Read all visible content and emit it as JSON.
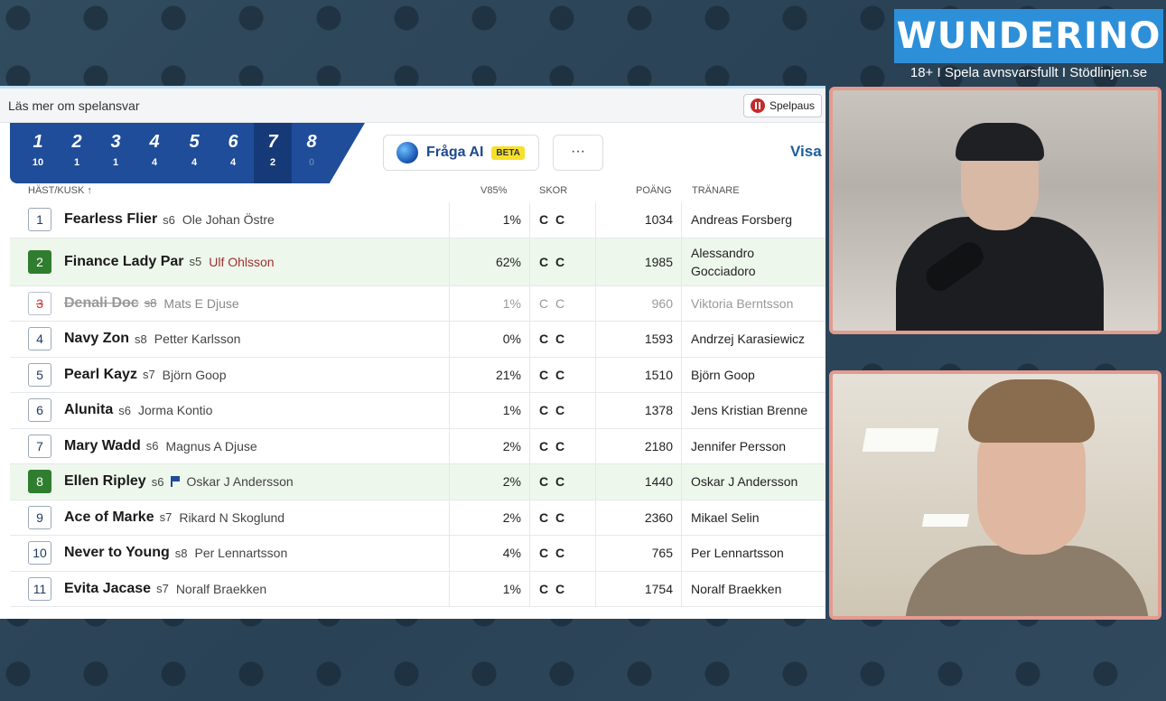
{
  "brand": {
    "logo": "WUNDERINO",
    "tagline": "18+ I Spela avnsvarsfullt I Stödlinjen.se"
  },
  "topbar": {
    "link": "Läs mer om spelansvar",
    "spelpaus": "Spelpaus"
  },
  "race_tabs": [
    {
      "num": "1",
      "count": "10"
    },
    {
      "num": "2",
      "count": "1"
    },
    {
      "num": "3",
      "count": "1"
    },
    {
      "num": "4",
      "count": "4"
    },
    {
      "num": "5",
      "count": "4"
    },
    {
      "num": "6",
      "count": "4"
    },
    {
      "num": "7",
      "count": "2",
      "active": true
    },
    {
      "num": "8",
      "count": "0"
    }
  ],
  "toolbar": {
    "ai_label": "Fråga AI",
    "beta": "BETA",
    "more": "···",
    "visa": "Visa"
  },
  "columns": {
    "horse": "HÄST/KUSK ↑",
    "v85": "V85%",
    "skor": "SKOR",
    "poang": "POÄNG",
    "tranare": "TRÄNARE"
  },
  "rows": [
    {
      "n": "1",
      "horse": "Fearless Flier",
      "tag": "s6",
      "driver": "Ole Johan Östre",
      "pct": "1%",
      "skor": "C C",
      "pts": "1034",
      "trainer": "Andreas Forsberg"
    },
    {
      "n": "2",
      "horse": "Finance Lady Par",
      "tag": "s5",
      "driver": "Ulf Ohlsson",
      "pct": "62%",
      "skor": "C C",
      "pts": "1985",
      "trainer": "Alessandro",
      "trainer2": "Gocciadoro"
    },
    {
      "n": "3",
      "horse": "Denali Doc",
      "tag": "s8",
      "driver": "Mats E Djuse",
      "pct": "1%",
      "skor": "C C",
      "pts": "960",
      "trainer": "Viktoria Berntsson"
    },
    {
      "n": "4",
      "horse": "Navy Zon",
      "tag": "s8",
      "driver": "Petter Karlsson",
      "pct": "0%",
      "skor": "C C",
      "pts": "1593",
      "trainer": "Andrzej Karasiewicz"
    },
    {
      "n": "5",
      "horse": "Pearl Kayz",
      "tag": "s7",
      "driver": "Björn Goop",
      "pct": "21%",
      "skor": "C C",
      "pts": "1510",
      "trainer": "Björn Goop"
    },
    {
      "n": "6",
      "horse": "Alunita",
      "tag": "s6",
      "driver": "Jorma Kontio",
      "pct": "1%",
      "skor": "C C",
      "pts": "1378",
      "trainer": "Jens Kristian Brenne"
    },
    {
      "n": "7",
      "horse": "Mary Wadd",
      "tag": "s6",
      "driver": "Magnus A Djuse",
      "pct": "2%",
      "skor": "C C",
      "pts": "2180",
      "trainer": "Jennifer Persson"
    },
    {
      "n": "8",
      "horse": "Ellen Ripley",
      "tag": "s6",
      "driver": "Oskar J Andersson",
      "pct": "2%",
      "skor": "C C",
      "pts": "1440",
      "trainer": "Oskar J Andersson"
    },
    {
      "n": "9",
      "horse": "Ace of Marke",
      "tag": "s7",
      "driver": "Rikard N Skoglund",
      "pct": "2%",
      "skor": "C C",
      "pts": "2360",
      "trainer": "Mikael Selin"
    },
    {
      "n": "10",
      "horse": "Never to Young",
      "tag": "s8",
      "driver": "Per Lennartsson",
      "pct": "4%",
      "skor": "C C",
      "pts": "765",
      "trainer": "Per Lennartsson"
    },
    {
      "n": "11",
      "horse": "Evita Jacase",
      "tag": "s7",
      "driver": "Noralf Braekken",
      "pct": "1%",
      "skor": "C C",
      "pts": "1754",
      "trainer": "Noralf Braekken"
    }
  ]
}
